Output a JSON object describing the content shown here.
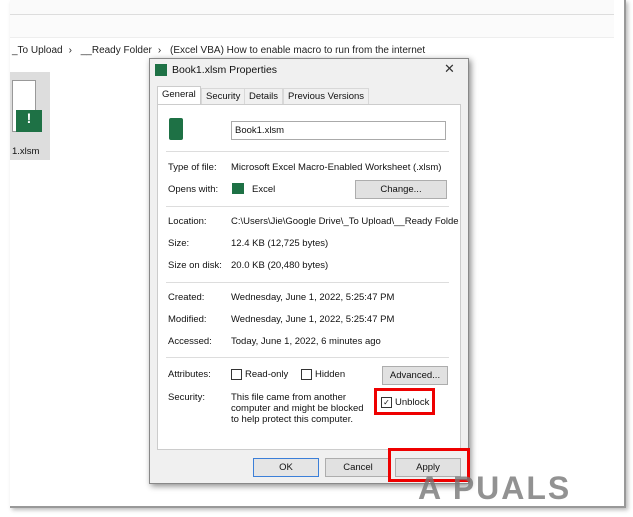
{
  "explorer": {
    "breadcrumb": [
      "_To Upload",
      "__Ready Folder",
      "(Excel VBA) How to enable macro to run from the internet"
    ],
    "file_label": "1.xlsm"
  },
  "dialog": {
    "title": "Book1.xlsm Properties",
    "tabs": [
      "General",
      "Security",
      "Details",
      "Previous Versions"
    ],
    "filename": "Book1.xlsm",
    "type_label": "Type of file:",
    "type_value": "Microsoft Excel Macro-Enabled Worksheet (.xlsm)",
    "opens_label": "Opens with:",
    "opens_value": "Excel",
    "change_label": "Change...",
    "location_label": "Location:",
    "location_value": "C:\\Users\\Jie\\Google Drive\\_To Upload\\__Ready Folde",
    "size_label": "Size:",
    "size_value": "12.4 KB (12,725 bytes)",
    "disk_label": "Size on disk:",
    "disk_value": "20.0 KB (20,480 bytes)",
    "created_label": "Created:",
    "created_value": "Wednesday, June 1, 2022, 5:25:47 PM",
    "modified_label": "Modified:",
    "modified_value": "Wednesday, June 1, 2022, 5:25:47 PM",
    "accessed_label": "Accessed:",
    "accessed_value": "Today, June 1, 2022, 6 minutes ago",
    "attributes_label": "Attributes:",
    "readonly_label": "Read-only",
    "hidden_label": "Hidden",
    "advanced_label": "Advanced...",
    "security_label": "Security:",
    "security_text": "This file came from another computer and might be blocked to help protect this computer.",
    "unblock_label": "Unblock",
    "unblock_checked": true,
    "ok_label": "OK",
    "cancel_label": "Cancel",
    "apply_label": "Apply"
  },
  "watermark": "A PUALS",
  "colors": {
    "highlight": "#e00000",
    "excel_green": "#1e7145"
  }
}
